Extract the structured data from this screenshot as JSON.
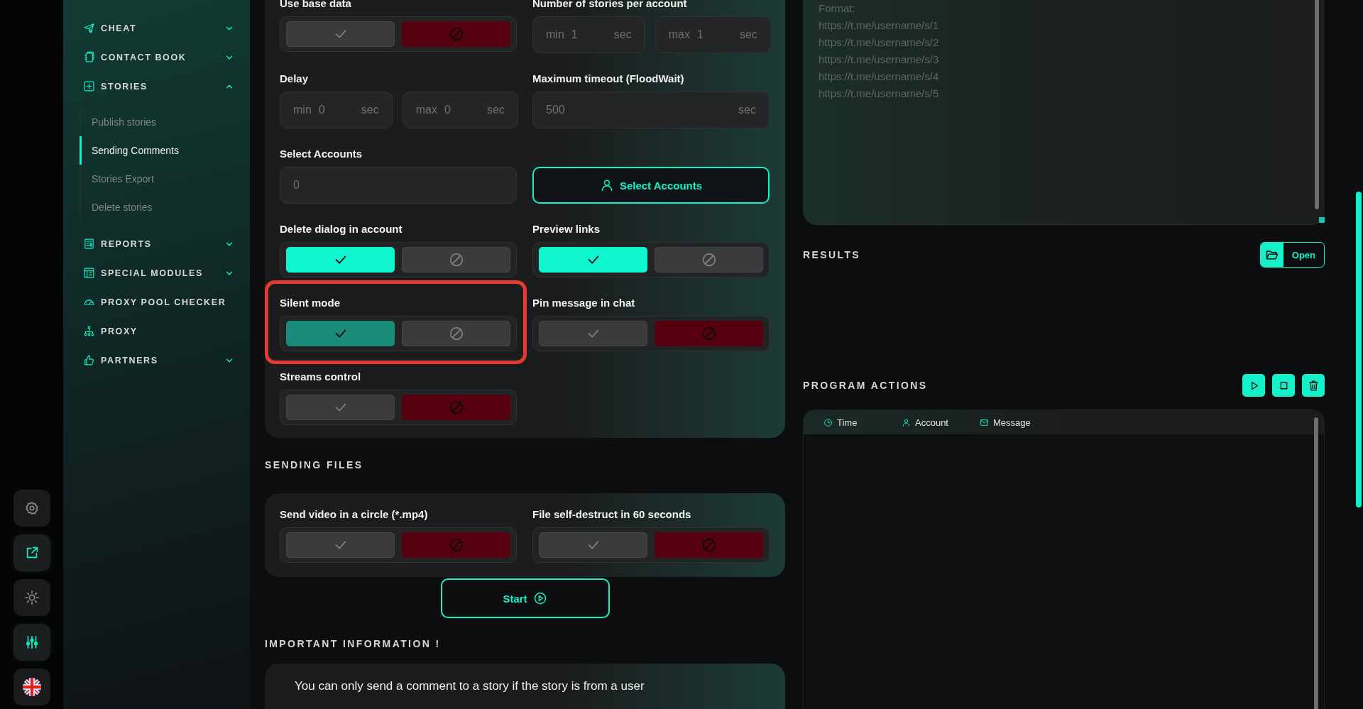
{
  "rail": [
    {
      "highlighted": false
    },
    {
      "highlighted": true
    },
    {
      "highlighted": false
    },
    {
      "highlighted": true
    }
  ],
  "sidebar": {
    "items": [
      {
        "label": "CHEAT",
        "expandable": true,
        "expanded": false
      },
      {
        "label": "CONTACT BOOK",
        "expandable": true,
        "expanded": false
      },
      {
        "label": "STORIES",
        "expandable": true,
        "expanded": true,
        "children": [
          {
            "label": "Publish stories",
            "selected": false
          },
          {
            "label": "Sending Comments",
            "selected": true
          },
          {
            "label": "Stories Export",
            "selected": false
          },
          {
            "label": "Delete stories",
            "selected": false
          }
        ]
      },
      {
        "label": "REPORTS",
        "expandable": true,
        "expanded": false
      },
      {
        "label": "SPECIAL MODULES",
        "expandable": true,
        "expanded": false
      },
      {
        "label": "PROXY POOL CHECKER",
        "expandable": false
      },
      {
        "label": "PROXY",
        "expandable": false
      },
      {
        "label": "PARTNERS",
        "expandable": true,
        "expanded": false
      }
    ]
  },
  "settings": {
    "fields": [
      {
        "kind": "toggle",
        "label": "Use base data",
        "checked": false,
        "dimmed": false,
        "highlighted": false
      },
      {
        "kind": "range",
        "label": "Number of stories per account",
        "min": {
          "prefix": "min",
          "value": "1",
          "unit": "sec"
        },
        "max": {
          "prefix": "max",
          "value": "1",
          "unit": "sec"
        },
        "highlighted": false
      },
      {
        "kind": "range",
        "label": "Delay",
        "min": {
          "prefix": "min",
          "value": "0",
          "unit": "sec"
        },
        "max": {
          "prefix": "max",
          "value": "0",
          "unit": "sec"
        },
        "highlighted": false
      },
      {
        "kind": "number",
        "label": "Maximum timeout (FloodWait)",
        "value": "500",
        "unit": "sec",
        "highlighted": false
      },
      {
        "kind": "number",
        "label": "Select Accounts",
        "value": "0",
        "highlighted": false
      },
      {
        "kind": "button",
        "label": "Select Accounts",
        "highlighted": false
      },
      {
        "kind": "toggle",
        "label": "Delete dialog in account",
        "checked": true,
        "dimmed": false,
        "highlighted": false
      },
      {
        "kind": "toggle",
        "label": "Preview links",
        "checked": true,
        "dimmed": false,
        "highlighted": false
      },
      {
        "kind": "toggle",
        "label": "Silent mode",
        "checked": true,
        "dimmed": true,
        "highlighted": true
      },
      {
        "kind": "toggle",
        "label": "Pin message in chat",
        "checked": false,
        "dimmed": false,
        "highlighted": false
      },
      {
        "kind": "toggle",
        "label": "Streams control",
        "checked": false,
        "dimmed": false,
        "highlighted": false
      }
    ]
  },
  "sending_files": {
    "title": "SENDING FILES",
    "fields": [
      {
        "kind": "toggle",
        "label": "Send video in a circle (*.mp4)",
        "checked": false,
        "dimmed": false,
        "highlighted": false
      },
      {
        "kind": "toggle",
        "label": "File self-destruct in 60 seconds",
        "checked": false,
        "dimmed": false,
        "highlighted": false
      }
    ]
  },
  "start_button": {
    "label": "Start"
  },
  "important_info": {
    "title": "IMPORTANT INFORMATION !",
    "text": "You can only send a comment to a story if the story is from a user"
  },
  "links_field": {
    "placeholder": [
      "Format:",
      "https://t.me/username/s/1",
      "https://t.me/username/s/2",
      "https://t.me/username/s/3",
      "https://t.me/username/s/4",
      "https://t.me/username/s/5"
    ]
  },
  "results": {
    "title": "RESULTS",
    "open_button": {
      "label": "Open"
    }
  },
  "program_actions": {
    "title": "PROGRAM ACTIONS"
  },
  "log_table": {
    "columns": [
      "Time",
      "Account",
      "Message"
    ]
  }
}
